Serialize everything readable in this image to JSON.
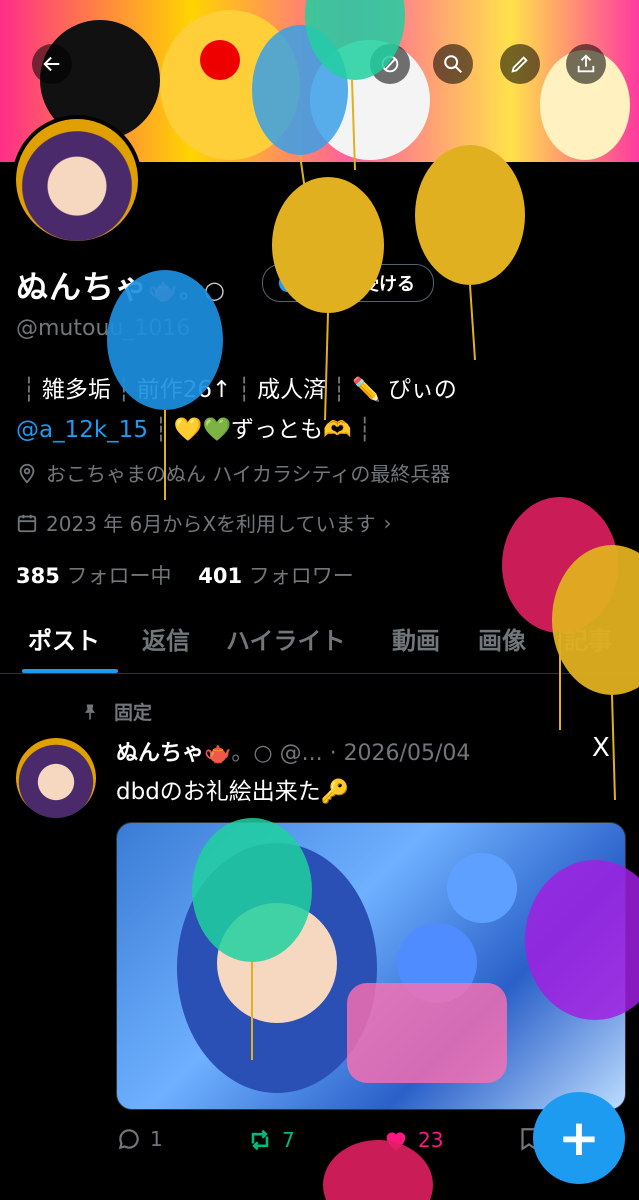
{
  "header": {
    "back_icon": "arrow-left-icon",
    "actions": [
      "grok-icon",
      "search-icon",
      "edit-icon",
      "share-icon"
    ]
  },
  "profile": {
    "name": "ぬんちゃ",
    "name_suffix": "🫖。○",
    "verify_label": "認証を受ける",
    "handle": "@mutouu_1016",
    "bio_line1": [
      "雑多垢",
      "前作26↑",
      "成人済",
      "✏️ ぴぃの"
    ],
    "bio_link": "@a_12k_15",
    "bio_line2_rest": "💛💚ずっとも🫶",
    "location": "おこちゃまのぬん ハイカラシティの最終兵器",
    "joined": "2023 年 6月からXを利用しています",
    "following_count": "385",
    "following_label": "フォロー中",
    "followers_count": "401",
    "followers_label": "フォロワー"
  },
  "tabs": [
    "ポスト",
    "返信",
    "ハイライト",
    "動画",
    "画像",
    "記事"
  ],
  "pinned_post": {
    "pinned_label": "固定",
    "author": "ぬんちゃ",
    "author_suffix": "🫖。○ @...",
    "date": "· 2026/05/04",
    "platform_icon": "X",
    "text": "dbdのお礼絵出来た🔑",
    "replies": "1",
    "reposts": "7",
    "likes": "23"
  },
  "fab_label": "+",
  "colors": {
    "accent": "#1d9bf0",
    "repost": "#00ba7c",
    "like": "#f91880"
  }
}
